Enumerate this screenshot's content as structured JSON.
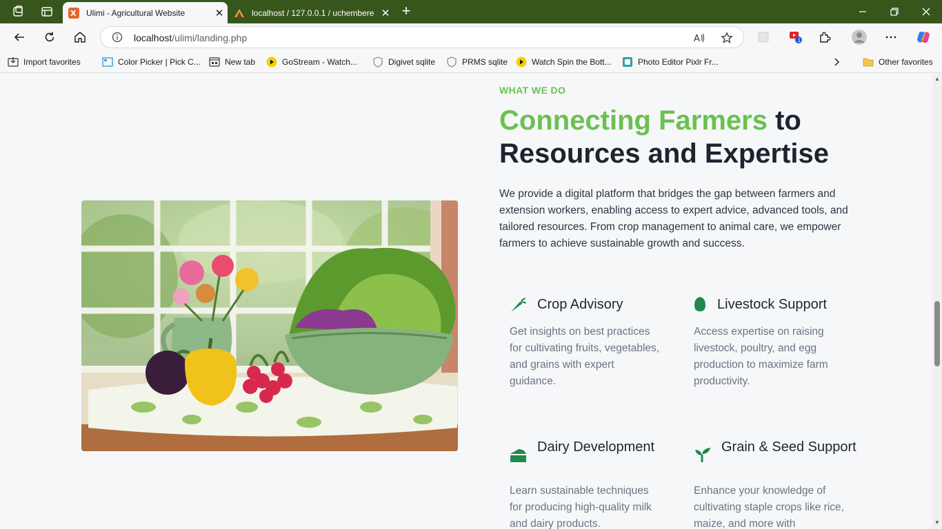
{
  "browser": {
    "tabs": [
      {
        "title": "Ulimi - Agricultural Website"
      },
      {
        "title": "localhost / 127.0.0.1 / uchembere"
      }
    ],
    "url_host": "localhost",
    "url_path": "/ulimi/landing.php",
    "profile_badge": "1"
  },
  "favorites": [
    {
      "label": "Import favorites"
    },
    {
      "label": "Color Picker | Pick C..."
    },
    {
      "label": "New tab"
    },
    {
      "label": "GoStream - Watch..."
    },
    {
      "label": "Digivet sqlite"
    },
    {
      "label": "PRMS sqlite"
    },
    {
      "label": "Watch Spin the Bott..."
    },
    {
      "label": "Photo Editor Pixlr Fr..."
    },
    {
      "label": "Other favorites"
    }
  ],
  "section": {
    "eyebrow": "WHAT WE DO",
    "headline_accent": "Connecting Farmers",
    "headline_rest_1": " to",
    "headline_rest_2": "Resources and Expertise",
    "intro": "We provide a digital platform that bridges the gap between farmers and extension workers, enabling access to expert advice, advanced tools, and tailored resources. From crop management to animal care, we empower farmers to achieve sustainable growth and success.",
    "features": [
      {
        "title": "Crop Advisory",
        "desc": "Get insights on best practices for cultivating fruits, vegetables, and grains with expert guidance.",
        "icon": "carrot-icon"
      },
      {
        "title": "Livestock Support",
        "desc": "Access expertise on raising livestock, poultry, and egg production to maximize farm productivity.",
        "icon": "egg-icon"
      },
      {
        "title": "Dairy Development",
        "desc": "Learn sustainable techniques for producing high-quality milk and dairy products.",
        "icon": "cheese-icon"
      },
      {
        "title": "Grain & Seed Support",
        "desc": "Enhance your knowledge of cultivating staple crops like rice, maize, and more with",
        "icon": "seedling-icon"
      }
    ]
  },
  "colors": {
    "accent": "#6ac14f",
    "icon_green": "#1f8a4c",
    "titlebar": "#37561c"
  }
}
